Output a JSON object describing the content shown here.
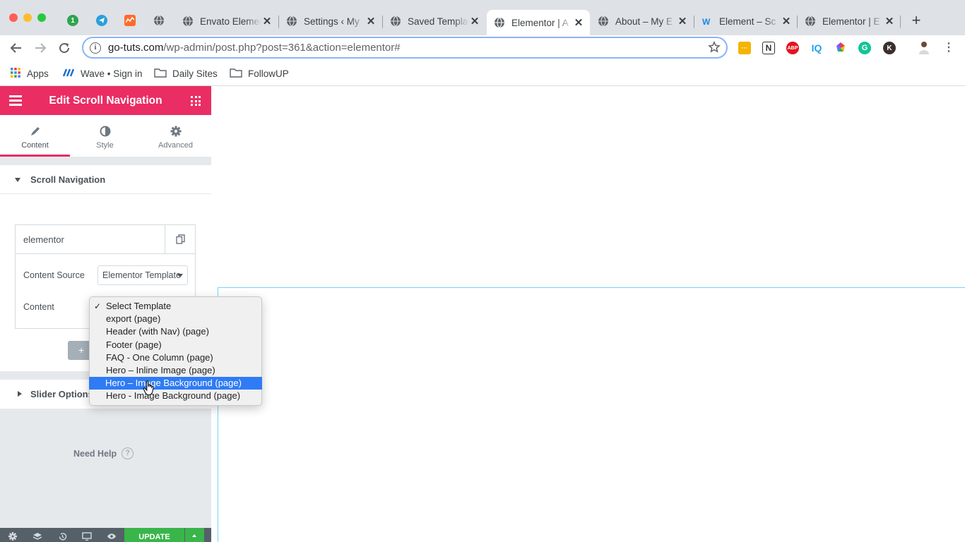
{
  "browser": {
    "tabs": [
      {
        "title": "Envato Elements",
        "active": false
      },
      {
        "title": "Settings ‹ My",
        "active": false
      },
      {
        "title": "Saved Templates",
        "active": false
      },
      {
        "title": "Elementor | A",
        "active": true
      },
      {
        "title": "About – My E",
        "active": false
      },
      {
        "title": "Element – Sc",
        "active": false
      },
      {
        "title": "Elementor | E",
        "active": false
      }
    ],
    "pinned_tabs": [
      {
        "icon": "green-one-icon",
        "text": "1",
        "color": "#2da44e"
      },
      {
        "icon": "telegram-icon",
        "text": "",
        "color": "#2aa1da"
      },
      {
        "icon": "activity-icon",
        "text": "",
        "color": "#ff6a2b"
      },
      {
        "icon": "globe-icon",
        "text": "",
        "color": "#5f6368"
      }
    ],
    "url_host": "go-tuts.com",
    "url_path": "/wp-admin/post.php?post=361&action=elementor#",
    "extensions": [
      {
        "icon": "note-extension-icon",
        "text": "···",
        "color": "#f5b400"
      },
      {
        "icon": "n-extension-icon",
        "text": "N",
        "color": "#333333"
      },
      {
        "icon": "adblock-plus-icon",
        "text": "ABP",
        "color": "#e2151f"
      },
      {
        "icon": "iq-extension-icon",
        "text": "IQ",
        "color": "#1da1f2"
      },
      {
        "icon": "color-wheel-extension-icon",
        "text": "",
        "color": "#7b4dff"
      },
      {
        "icon": "grammarly-icon",
        "text": "G",
        "color": "#15c39a"
      },
      {
        "icon": "k-extension-icon",
        "text": "K",
        "color": "#3b2f2f"
      }
    ],
    "bookmarks": [
      {
        "label": "Apps",
        "icon": "apps-grid-icon"
      },
      {
        "label": "Wave • Sign in",
        "icon": "wave-icon"
      },
      {
        "label": "Daily Sites",
        "icon": "folder-icon"
      },
      {
        "label": "FollowUP",
        "icon": "folder-icon"
      }
    ]
  },
  "panel": {
    "header_title": "Edit Scroll Navigation",
    "accent": "#ea2d63",
    "tabs": [
      {
        "label": "Content",
        "icon": "pencil-icon",
        "active": true
      },
      {
        "label": "Style",
        "icon": "contrast-icon",
        "active": false
      },
      {
        "label": "Advanced",
        "icon": "gear-icon",
        "active": false
      }
    ],
    "section_title": "Scroll Navigation",
    "repeater_item_title": "elementor",
    "content_source_label": "Content Source",
    "content_source_value": "Elementor Template",
    "content_label": "Content",
    "add_item_label": "+",
    "slider_section_title": "Slider Options",
    "need_help": "Need Help",
    "help_icon": "?",
    "update_label": "UPDATE"
  },
  "dropdown": {
    "options": [
      {
        "label": "Select Template",
        "checked": true,
        "highlighted": false
      },
      {
        "label": "export (page)",
        "checked": false,
        "highlighted": false
      },
      {
        "label": "Header (with Nav) (page)",
        "checked": false,
        "highlighted": false
      },
      {
        "label": "Footer (page)",
        "checked": false,
        "highlighted": false
      },
      {
        "label": "FAQ - One Column (page)",
        "checked": false,
        "highlighted": false
      },
      {
        "label": "Hero – Inline Image (page)",
        "checked": false,
        "highlighted": false
      },
      {
        "label": "Hero – Image Background (page)",
        "checked": false,
        "highlighted": true
      },
      {
        "label": "Hero - Image Background (page)",
        "checked": false,
        "highlighted": false
      }
    ],
    "highlight_color": "#2f7bf5"
  }
}
